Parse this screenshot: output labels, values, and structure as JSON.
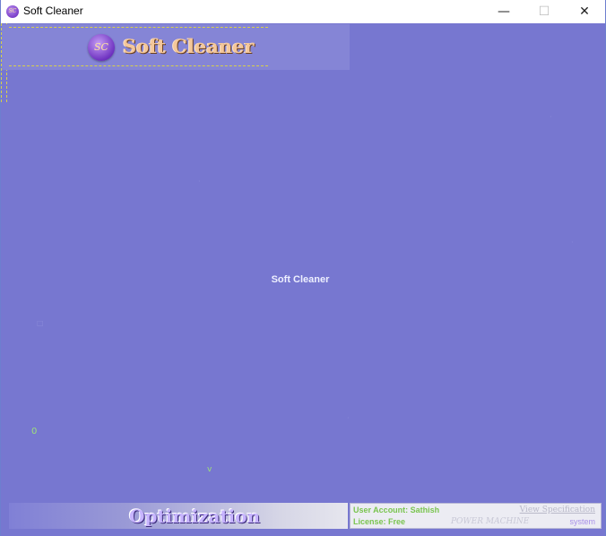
{
  "window": {
    "title": "Soft Cleaner",
    "icon_text": "SC",
    "controls": {
      "minimize": "—",
      "maximize": "☐",
      "close": "✕"
    }
  },
  "header": {
    "logo_mark": "SC",
    "logo_text": "Soft Cleaner"
  },
  "main": {
    "center_label": "Soft Cleaner",
    "mark_zero": "0",
    "mark_v": "v"
  },
  "footer": {
    "optimization_label": "Optimization",
    "user_account": "User Account: Sathish",
    "license": "License: Free",
    "view_specification": "View Specification",
    "power_machine": "POWER MACHINE",
    "system": "system"
  },
  "colors": {
    "background": "#7777d0",
    "header_panel": "#8585d6",
    "accent_green": "#7ac44f",
    "logo_text": "#f4c79a"
  }
}
